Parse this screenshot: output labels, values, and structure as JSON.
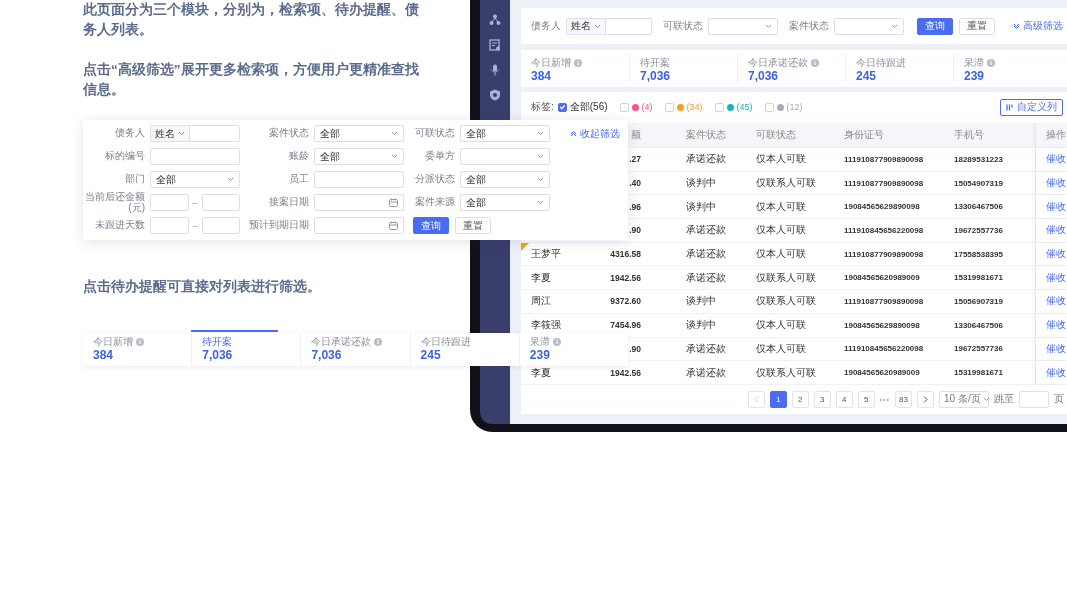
{
  "intro_text": [
    "此页面分为三个模块，分别为，检索项、待办提醒、债务人列表。",
    "点击“高级筛选”展开更多检索项，方便用户更精准查找信息。"
  ],
  "advanced_filter": {
    "collapse_link": "收起筛选",
    "rows": [
      [
        {
          "label": "债务人",
          "kind": "name_input",
          "prefix": "姓名"
        },
        {
          "label": "案件状态",
          "kind": "select",
          "value": "全部"
        },
        {
          "label": "可联状态",
          "kind": "select",
          "value": "全部"
        }
      ],
      [
        {
          "label": "标的编号",
          "kind": "input"
        },
        {
          "label": "账龄",
          "kind": "select",
          "value": "全部"
        },
        {
          "label": "委单方",
          "kind": "select"
        }
      ],
      [
        {
          "label": "部门",
          "kind": "select",
          "value": "全部"
        },
        {
          "label": "员工",
          "kind": "input"
        },
        {
          "label": "分派状态",
          "kind": "select",
          "value": "全部"
        }
      ],
      [
        {
          "label": "当前后还金额(元)",
          "kind": "range",
          "separator": "–"
        },
        {
          "label": "接案日期",
          "kind": "date"
        },
        {
          "label": "案件来源",
          "kind": "select",
          "value": "全部"
        }
      ],
      [
        {
          "label": "未跟进天数",
          "kind": "range",
          "separator": "–"
        },
        {
          "label": "预计到期日期",
          "kind": "date"
        },
        {
          "kind": "buttons",
          "buttons": [
            {
              "label": "查询",
              "primary": true
            },
            {
              "label": "重置",
              "primary": false
            }
          ]
        }
      ]
    ]
  },
  "todo_text": "点击待办提醒可直接对列表进行筛选。",
  "todo_panel": [
    {
      "label": "今日新增",
      "value": "384",
      "help": true,
      "selected": false
    },
    {
      "label": "待开案",
      "value": "7,036",
      "help": false,
      "selected": true
    },
    {
      "label": "今日承诺还款",
      "value": "7,036",
      "help": true,
      "selected": false
    },
    {
      "label": "今日待跟进",
      "value": "245",
      "help": false,
      "selected": false
    },
    {
      "label": "呆滞",
      "value": "239",
      "help": true,
      "selected": false
    }
  ],
  "tablet": {
    "filter_bar": {
      "fields": [
        {
          "label": "债务人",
          "kind": "name_input",
          "prefix": "姓名"
        },
        {
          "label": "可联状态",
          "kind": "select"
        },
        {
          "label": "案件状态",
          "kind": "select"
        }
      ],
      "buttons": [
        {
          "label": "查询",
          "primary": true
        },
        {
          "label": "重置",
          "primary": false
        }
      ],
      "advanced_link": "高级筛选"
    },
    "stats": [
      {
        "label": "今日新增",
        "value": "384",
        "help": true,
        "selected": false
      },
      {
        "label": "待开案",
        "value": "7,036",
        "help": false,
        "selected": false
      },
      {
        "label": "今日承诺还款",
        "value": "7,036",
        "help": true,
        "selected": false
      },
      {
        "label": "今日待跟进",
        "value": "245",
        "help": false,
        "selected": false
      },
      {
        "label": "呆滞",
        "value": "239",
        "help": true,
        "selected": false
      }
    ],
    "tags": {
      "label": "标签:",
      "all": {
        "text": "全部(56)",
        "checked": true
      },
      "items": [
        {
          "count": "(4)",
          "color": "#f0587e",
          "checked": false
        },
        {
          "count": "(34)",
          "color": "#f7a21b",
          "checked": false
        },
        {
          "count": "(45)",
          "color": "#16b5c4",
          "checked": false
        },
        {
          "count": "(12)",
          "color": "#a4adbb",
          "checked": false
        }
      ]
    },
    "customize_button": "自定义列",
    "table": {
      "header": {
        "amount": "额",
        "case_status": "案件状态",
        "contact_status": "可联状态",
        "id_number": "身份证号",
        "phone": "手机号",
        "action": "操作"
      },
      "rows": [
        {
          "amount": ".27",
          "case_status": "承诺还款",
          "contact_status": "仅本人可联",
          "id_number": "111910877909890098",
          "phone": "18289531223",
          "action": "催收"
        },
        {
          "amount": ".40",
          "case_status": "谈判中",
          "contact_status": "仅联系人可联",
          "id_number": "111910877909890098",
          "phone": "15054907319",
          "action": "催收"
        },
        {
          "amount": ".96",
          "case_status": "谈判中",
          "contact_status": "仅本人可联",
          "id_number": "19084565629890098",
          "phone": "13306467506",
          "action": "催收"
        },
        {
          "amount": ".90",
          "case_status": "承诺还款",
          "contact_status": "仅本人可联",
          "id_number": "111910845656220098",
          "phone": "19672557736",
          "action": "催收"
        },
        {
          "name": "王梦平",
          "amount": "4316.58",
          "case_status": "承诺还款",
          "contact_status": "仅本人可联",
          "id_number": "111910877909890098",
          "phone": "17558538395",
          "action": "催收",
          "color": "#f7a21b"
        },
        {
          "name": "李夏",
          "amount": "1942.56",
          "case_status": "承诺还款",
          "contact_status": "仅联系人可联",
          "id_number": "19084565620989009",
          "phone": "15319981671",
          "action": "催收"
        },
        {
          "name": "周江",
          "amount": "9372.60",
          "case_status": "谈判中",
          "contact_status": "仅联系人可联",
          "id_number": "111910877909890098",
          "phone": "15056907319",
          "action": "催收"
        },
        {
          "name": "李筱强",
          "amount": "7454.96",
          "case_status": "谈判中",
          "contact_status": "仅本人可联",
          "id_number": "19084565629890098",
          "phone": "13306467506",
          "action": "催收"
        },
        {
          "amount": ".90",
          "case_status": "承诺还款",
          "contact_status": "仅本人可联",
          "id_number": "111910845656220098",
          "phone": "19672557736",
          "action": "催收"
        },
        {
          "name": "李夏",
          "amount": "1942.56",
          "case_status": "承诺还款",
          "contact_status": "仅联系人可联",
          "id_number": "19084565620989009",
          "phone": "15319981671",
          "action": "催收"
        }
      ]
    },
    "pagination": {
      "prev_disabled": true,
      "pages": [
        {
          "label": "1",
          "selected": true
        },
        {
          "label": "2",
          "selected": false
        },
        {
          "label": "3",
          "selected": false
        },
        {
          "label": "4",
          "selected": false
        },
        {
          "label": "5",
          "selected": false
        }
      ],
      "ellipsis": "•••",
      "last_page": "83",
      "page_size": "10 条/页",
      "jump_label": "跳至",
      "page_unit": "页"
    }
  }
}
